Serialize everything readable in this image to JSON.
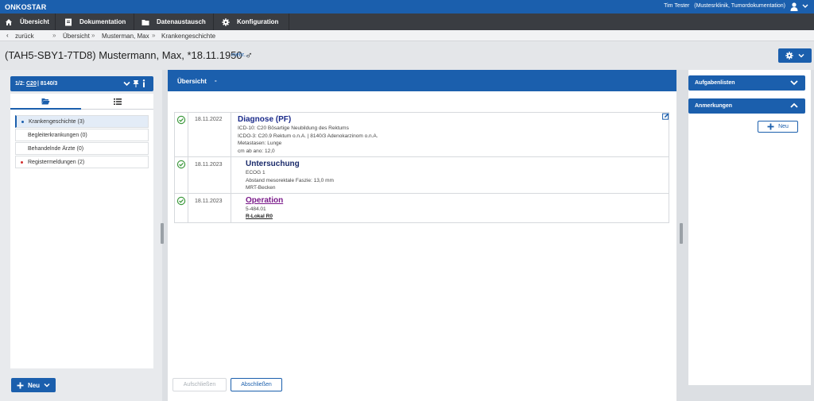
{
  "app": {
    "logo": "ONKOSTAR"
  },
  "user": {
    "name": "Tim Tester",
    "context": "(Mustesrklinik, Tumordokumentation)"
  },
  "nav": [
    {
      "label": "Übersicht",
      "icon": "home-icon"
    },
    {
      "label": "Dokumentation",
      "icon": "document-icon"
    },
    {
      "label": "Datenaustausch",
      "icon": "folder-icon"
    },
    {
      "label": "Konfiguration",
      "icon": "gear-icon"
    }
  ],
  "breadcrumb": {
    "back": "zurück",
    "items": [
      "Übersicht",
      "Musterman, Max",
      "Krankengeschichte"
    ]
  },
  "patient": {
    "title": "(TAH5-SBY1-7TD8) Mustermann, Max, *18.11.1950 ♂",
    "more": "mehr..."
  },
  "left": {
    "header": {
      "position": "1/2:",
      "code": "C20",
      "morph": "| 8140/3"
    },
    "items": [
      {
        "label": "Krankengeschichte (3)",
        "dot": "#1b5fad"
      },
      {
        "label": "Begleiterkrankungen (0)",
        "dot": ""
      },
      {
        "label": "Behandelnde Ärzte (0)",
        "dot": ""
      },
      {
        "label": "Registermeldungen (2)",
        "dot": "#d33030"
      }
    ],
    "new_label": "Neu"
  },
  "center": {
    "header": "Übersicht",
    "header_suffix": "-",
    "entries": [
      {
        "date": "18.11.2022",
        "title": "Diagnose (PF)",
        "lines": [
          "ICD-10: C20 Bösartige Neubildung des Rektums",
          "ICDO-3: C20.9 Rektum o.n.A. | 8140/3 Adenokarzinom o.n.A.",
          "Metastasen: Lunge",
          "cm ab ano: 12,0"
        ]
      },
      {
        "date": "18.11.2023",
        "title": "Untersuchung",
        "lines": [
          "ECOG 1",
          "Abstand mesorektale Faszie: 13,0 mm",
          "MRT-Becken"
        ]
      },
      {
        "date": "18.11.2023",
        "title": "Operation",
        "lines": [
          "5-484.01",
          "R-Lokal R0"
        ]
      }
    ],
    "btn_disabled": "Aufschließen",
    "btn_close": "Abschließen"
  },
  "right": {
    "tasks": "Aufgabenlisten",
    "notes": "Anmerkungen",
    "new_label": "Neu"
  },
  "colors": {
    "primary": "#1b5fad",
    "nav": "#3a3d42",
    "ok": "#3f9a3f"
  }
}
